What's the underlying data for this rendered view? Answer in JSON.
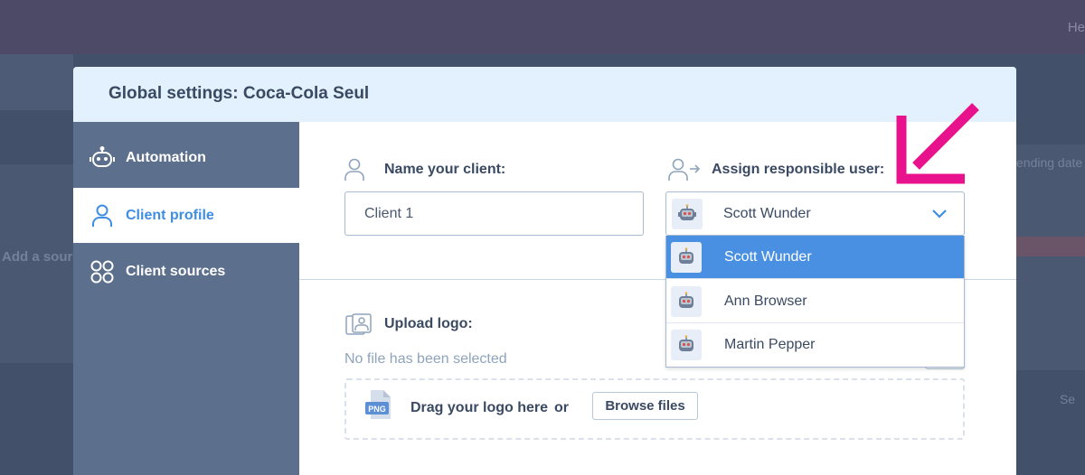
{
  "background": {
    "topbar_text": "He",
    "left_text": "Add a sourc",
    "right_text": "ending date",
    "right_text2": "Se"
  },
  "modal": {
    "title": "Global settings: Coca-Cola Seul"
  },
  "sidebar": {
    "items": [
      {
        "label": "Automation",
        "icon": "robot-icon",
        "active": false
      },
      {
        "label": "Client profile",
        "icon": "user-icon",
        "active": true
      },
      {
        "label": "Client sources",
        "icon": "four-circles-icon",
        "active": false
      }
    ]
  },
  "client_name": {
    "label": "Name your client:",
    "value": "Client 1"
  },
  "responsible_user": {
    "label": "Assign responsible user:",
    "selected": "Scott Wunder",
    "options": [
      "Scott Wunder",
      "Ann Browser",
      "Martin Pepper"
    ]
  },
  "logo_upload": {
    "label": "Upload logo:",
    "status": "No file has been selected",
    "drop_text": "Drag your logo here",
    "or_text": "or",
    "browse_label": "Browse files",
    "file_badge": "PNG"
  },
  "colors": {
    "accent": "#4a90e2",
    "sidebar": "#5c6f8c",
    "header": "#e3f0fd",
    "annotation_arrow": "#e8128c"
  }
}
